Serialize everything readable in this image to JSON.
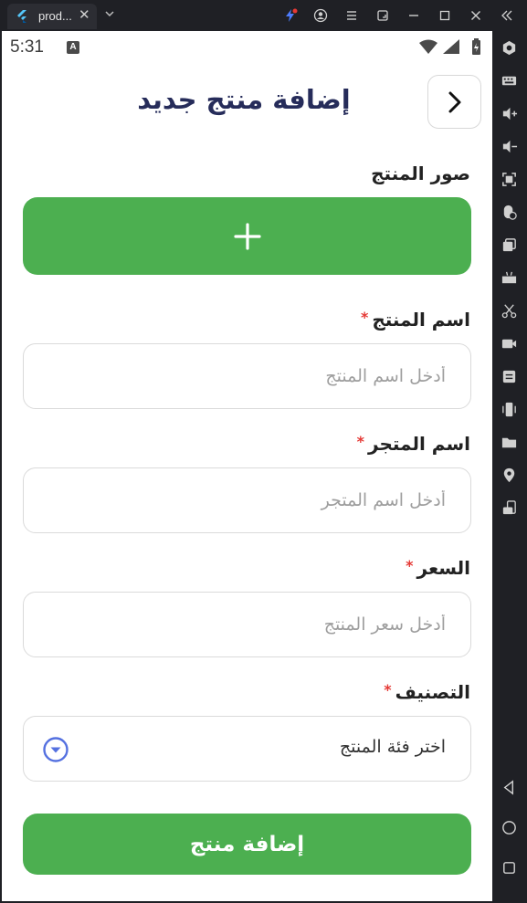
{
  "window": {
    "tab_title": "prod...",
    "tab_close": "✕"
  },
  "status_bar": {
    "time": "5:31",
    "notification_badge": "A"
  },
  "header": {
    "title": "إضافة منتج جديد",
    "back_icon": "chevron-right-icon"
  },
  "form": {
    "images_label": "صور المنتج",
    "upload_icon": "plus-icon",
    "required_mark": "*",
    "product_name": {
      "label": "اسم المنتج",
      "placeholder": "أدخل اسم المنتج",
      "value": ""
    },
    "store_name": {
      "label": "اسم المتجر",
      "placeholder": "أدخل اسم المتجر",
      "value": ""
    },
    "price": {
      "label": "السعر",
      "placeholder": "أدخل سعر المنتج",
      "value": ""
    },
    "category": {
      "label": "التصنيف",
      "selected": "اختر فئة المنتج"
    },
    "submit_label": "إضافة منتج"
  },
  "colors": {
    "primary_green": "#4caf50",
    "title_navy": "#262c5a",
    "required_red": "#e53935",
    "dropdown_blue": "#5470e0"
  }
}
